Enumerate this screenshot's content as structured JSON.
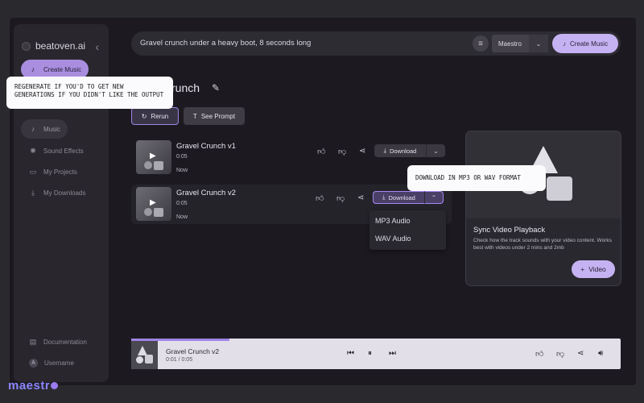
{
  "app": {
    "brand": "beatoven.ai",
    "footer_brand": "maestr",
    "footer_brand_dot": "o"
  },
  "sidebar": {
    "items": [
      {
        "label": "Create Music",
        "icon": "music-note-icon"
      },
      {
        "label": "Music",
        "icon": "music-note-icon"
      },
      {
        "label": "Sound Effects",
        "icon": "sparkle-icon"
      },
      {
        "label": "My Projects",
        "icon": "folder-icon"
      },
      {
        "label": "My Downloads",
        "icon": "download-icon"
      }
    ],
    "bottom": [
      {
        "label": "Documentation",
        "icon": "document-icon"
      },
      {
        "label": "Username",
        "avatar": "A"
      }
    ]
  },
  "prompt": {
    "text": "Gravel crunch under a heavy boot, 8 seconds long",
    "model": "Maestro",
    "create_label": "Create Music"
  },
  "project": {
    "title": "Gravel Crunch",
    "title_visible": "runch",
    "rerun_label": "Rerun",
    "see_prompt_label": "See Prompt"
  },
  "tracks": [
    {
      "name": "Gravel Crunch v1",
      "duration": "0:05",
      "created": "Now",
      "download_label": "Download"
    },
    {
      "name": "Gravel Crunch v2",
      "duration": "0:05",
      "created": "Now",
      "download_label": "Download"
    }
  ],
  "download_menu": {
    "options": [
      "MP3 Audio",
      "WAV Audio"
    ]
  },
  "sync_card": {
    "title": "Sync Video Playback",
    "description": "Check how the track sounds with your video content. Works best with videos under 2 mins and 2mb",
    "button_label": "Video"
  },
  "player": {
    "track_name": "Gravel Crunch v2",
    "time": "0:01 / 0:05",
    "progress": 0.2
  },
  "annotations": {
    "rerun_tip": "Regenerate if you'd to get new generations if you didn't like the output",
    "download_tip": "Download in MP3 or WAV format"
  },
  "colors": {
    "accent": "#c5b2f2",
    "accent_border": "#9e84e6",
    "background": "#1c1a20",
    "brand": "#8b85ff"
  }
}
